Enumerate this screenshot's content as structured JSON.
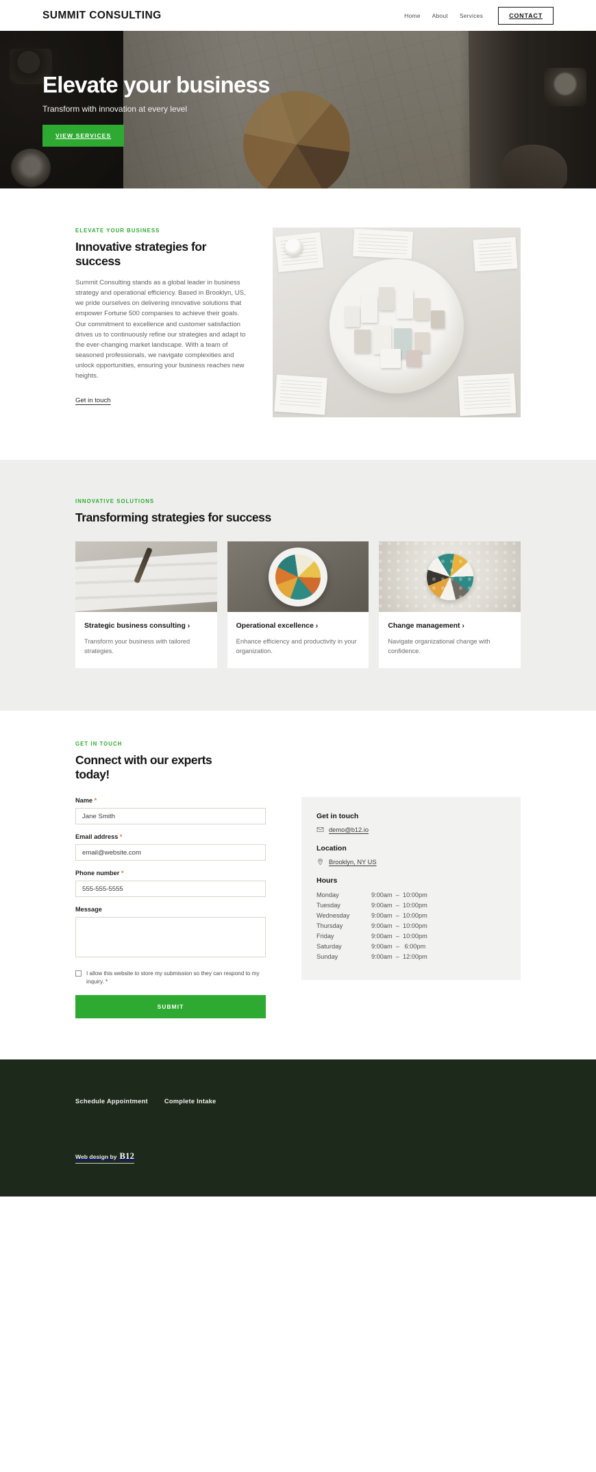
{
  "header": {
    "brand": "SUMMIT CONSULTING",
    "nav": [
      {
        "label": "Home"
      },
      {
        "label": "About"
      },
      {
        "label": "Services"
      }
    ],
    "cta_label": "CONTACT"
  },
  "hero": {
    "title": "Elevate your business",
    "subtitle": "Transform with innovation at every level",
    "button_label": "VIEW SERVICES",
    "accent_color": "#2eaa32"
  },
  "about": {
    "eyebrow": "ELEVATE YOUR BUSINESS",
    "heading": "Innovative strategies for success",
    "paragraph": "Summit Consulting stands as a global leader in business strategy and operational efficiency. Based in Brooklyn, US, we pride ourselves on delivering innovative solutions that empower Fortune 500 companies to achieve their goals. Our commitment to excellence and customer satisfaction drives us to continuously refine our strategies and adapt to the ever-changing market landscape. With a team of seasoned professionals, we navigate complexities and unlock opportunities, ensuring your business reaches new heights.",
    "link_label": "Get in touch"
  },
  "services": {
    "eyebrow": "INNOVATIVE SOLUTIONS",
    "heading": "Transforming strategies for success",
    "cards": [
      {
        "title": "Strategic business consulting ›",
        "desc": "Transform your business with tailored strategies."
      },
      {
        "title": "Operational excellence ›",
        "desc": "Enhance efficiency and productivity in your organization."
      },
      {
        "title": "Change management ›",
        "desc": "Navigate organizational change with confidence."
      }
    ]
  },
  "contact": {
    "eyebrow": "GET IN TOUCH",
    "heading": "Connect with our experts today!",
    "form": {
      "name_label": "Name",
      "name_value": "Jane Smith",
      "email_label": "Email address",
      "email_value": "email@website.com",
      "phone_label": "Phone number",
      "phone_value": "555-555-5555",
      "message_label": "Message",
      "message_value": "",
      "required_mark": "*",
      "consent_text": "I allow this website to store my submission so they can respond to my inquiry. *",
      "submit_label": "SUBMIT"
    },
    "info": {
      "get_in_touch_title": "Get in touch",
      "email": "demo@b12.io",
      "location_title": "Location",
      "location": "Brooklyn, NY US",
      "hours_title": "Hours",
      "hours": [
        {
          "day": "Monday",
          "time": "9:00am  –  10:00pm"
        },
        {
          "day": "Tuesday",
          "time": "9:00am  –  10:00pm"
        },
        {
          "day": "Wednesday",
          "time": "9:00am  –  10:00pm"
        },
        {
          "day": "Thursday",
          "time": "9:00am  –  10:00pm"
        },
        {
          "day": "Friday",
          "time": "9:00am  –  10:00pm"
        },
        {
          "day": "Saturday",
          "time": "9:00am  –   6:00pm"
        },
        {
          "day": "Sunday",
          "time": "9:00am  –  12:00pm"
        }
      ]
    }
  },
  "footer": {
    "links": [
      {
        "label": "Schedule Appointment"
      },
      {
        "label": "Complete Intake"
      }
    ],
    "credit_text": "Web design by",
    "credit_brand": "B12",
    "background_color": "#1d2a1b"
  }
}
